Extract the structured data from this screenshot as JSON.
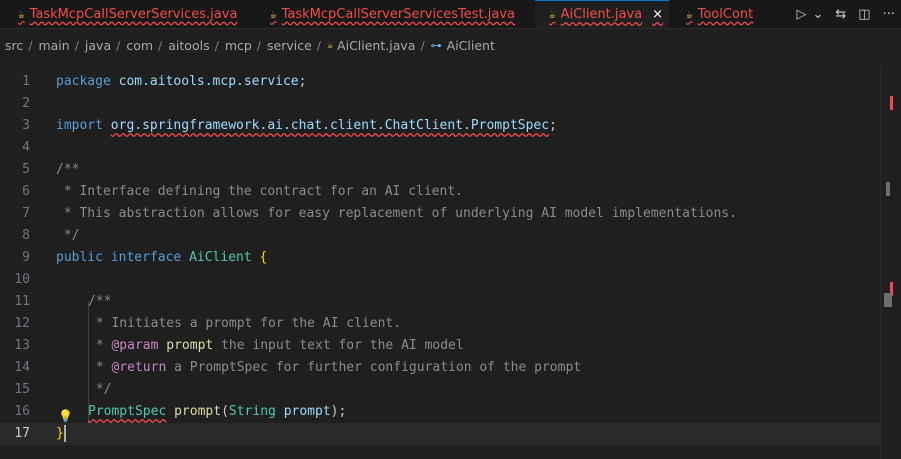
{
  "tabs": [
    {
      "label": "TaskMcpCallServerServices.java",
      "icon": "java-file-icon",
      "error": true,
      "active": false
    },
    {
      "label": "TaskMcpCallServerServicesTest.java",
      "icon": "java-file-icon",
      "error": true,
      "active": false
    },
    {
      "label": "AiClient.java",
      "icon": "java-file-icon",
      "error": true,
      "active": true,
      "close": "×"
    },
    {
      "label": "ToolCont",
      "icon": "java-file-icon",
      "error": true,
      "active": false
    }
  ],
  "tab_actions": {
    "run": "▷",
    "dropdown": "⌄",
    "compare": "⇆",
    "split": "◫",
    "more": "···"
  },
  "breadcrumb": [
    "src",
    "main",
    "java",
    "com",
    "aitools",
    "mcp",
    "service",
    "AiClient.java",
    "AiClient"
  ],
  "editor": {
    "line_numbers": [
      "1",
      "2",
      "3",
      "4",
      "5",
      "6",
      "7",
      "8",
      "9",
      "10",
      "11",
      "12",
      "13",
      "14",
      "15",
      "16",
      "17"
    ],
    "l1": {
      "kw": "package",
      "pkg": "com.aitools.mcp.service",
      "end": ";"
    },
    "l3": {
      "kw": "import",
      "pkg": "org.springframework.ai.chat.client.ChatClient.PromptSpec",
      "end": ";"
    },
    "l5": "/**",
    "l6": " * Interface defining the contract for an AI client.",
    "l7": " * This abstraction allows for easy replacement of underlying AI model implementations.",
    "l8": " */",
    "l9": {
      "kw1": "public",
      "kw2": "interface",
      "name": "AiClient",
      "brace": "{"
    },
    "l11": "/**",
    "l12": " * Initiates a prompt for the AI client.",
    "l13": {
      "star": " * ",
      "tag": "@param",
      "param": "prompt",
      "text": " the input text for the AI model"
    },
    "l14": {
      "star": " * ",
      "tag": "@return",
      "text": " a PromptSpec for further configuration of the prompt"
    },
    "l15": " */",
    "l16": {
      "type": "PromptSpec",
      "method": "prompt",
      "open": "(",
      "ptype": "String",
      "pname": "prompt",
      "close": ");"
    },
    "l17": "}"
  },
  "colors": {
    "error": "#f14c4c",
    "accent": "#0078d4",
    "keyword": "#569cd6",
    "type": "#4ec9b0",
    "comment": "#8b8b8b"
  }
}
